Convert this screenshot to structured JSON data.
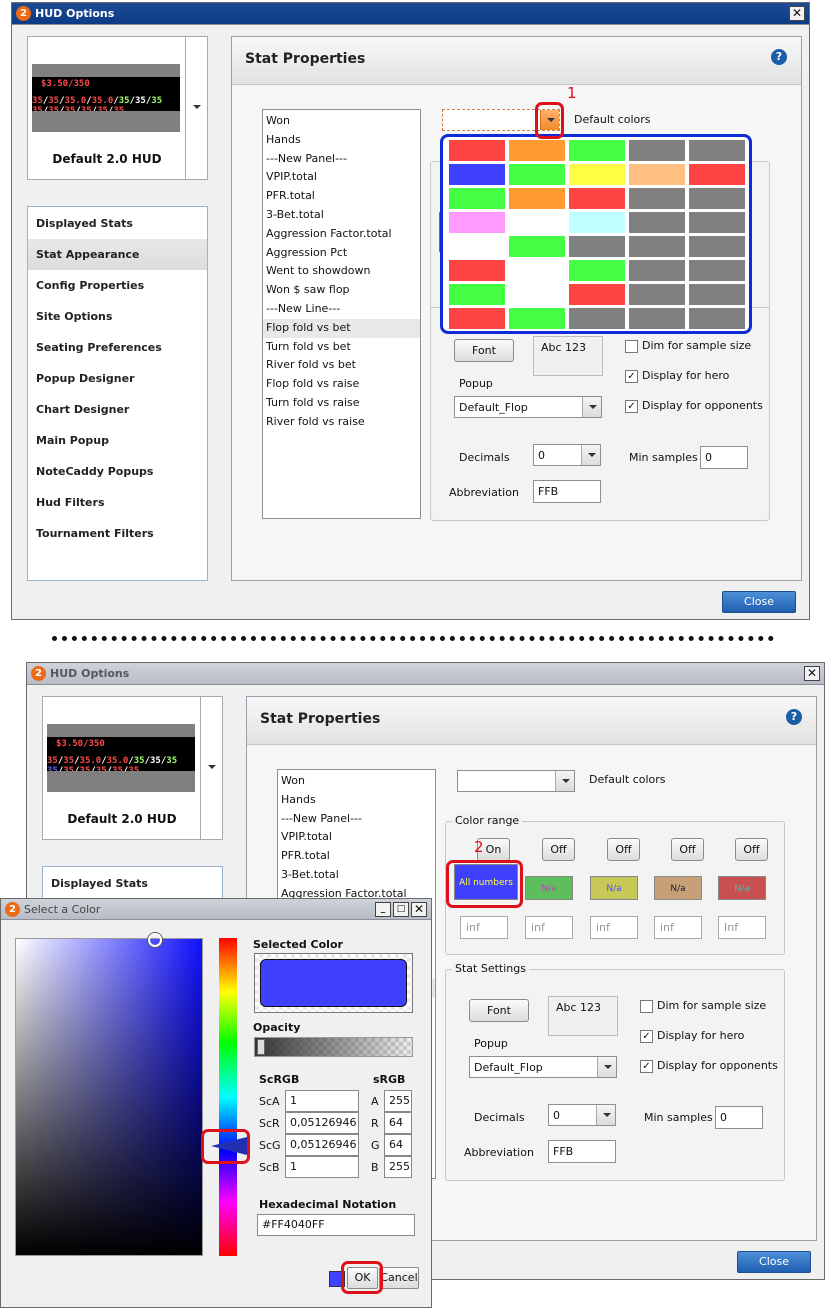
{
  "colors": {
    "accent_red": "#e0101a",
    "palette_border": "#0d2bd6",
    "selected_color": "#4040ff"
  },
  "window": {
    "title": "HUD Options",
    "logo": "2",
    "close_glyph": "✕"
  },
  "hud_preview": {
    "top_line": "$3.50/350",
    "line1": [
      {
        "t": "35",
        "c": "#ff4a4a"
      },
      {
        "t": "/",
        "c": "#ffffff"
      },
      {
        "t": "35",
        "c": "#ff4a4a"
      },
      {
        "t": "/",
        "c": "#ffffff"
      },
      {
        "t": "35.0",
        "c": "#ff4a4a"
      },
      {
        "t": "/",
        "c": "#ffffff"
      },
      {
        "t": "35.0",
        "c": "#ff4a4a"
      },
      {
        "t": "/",
        "c": "#ffffff"
      },
      {
        "t": "35",
        "c": "#9dff6a"
      },
      {
        "t": "/",
        "c": "#ffffff"
      },
      {
        "t": "35",
        "c": "#ffffff"
      },
      {
        "t": "/",
        "c": "#ffffff"
      },
      {
        "t": "35",
        "c": "#9dff6a"
      }
    ],
    "line2": [
      {
        "t": "35",
        "c": "#ff4a4a"
      },
      {
        "t": "/",
        "c": "#ffffff"
      },
      {
        "t": "35",
        "c": "#ff4a4a"
      },
      {
        "t": "/",
        "c": "#ffffff"
      },
      {
        "t": "35",
        "c": "#ff4a4a"
      },
      {
        "t": "/",
        "c": "#ffffff"
      },
      {
        "t": "35",
        "c": "#ff4a4a"
      },
      {
        "t": "/",
        "c": "#ffffff"
      },
      {
        "t": "35",
        "c": "#ff4a4a"
      },
      {
        "t": "/",
        "c": "#ffffff"
      },
      {
        "t": "35",
        "c": "#ff4a4a"
      }
    ],
    "line2_bottom": [
      {
        "t": "35",
        "c": "#5a5aff"
      },
      {
        "t": "/",
        "c": "#ffffff"
      },
      {
        "t": "35",
        "c": "#ff4a4a"
      },
      {
        "t": "/",
        "c": "#ffffff"
      },
      {
        "t": "35",
        "c": "#ff4a4a"
      },
      {
        "t": "/",
        "c": "#ffffff"
      },
      {
        "t": "35",
        "c": "#ff4a4a"
      },
      {
        "t": "/",
        "c": "#ffffff"
      },
      {
        "t": "35",
        "c": "#ff4a4a"
      },
      {
        "t": "/",
        "c": "#ffffff"
      },
      {
        "t": "35",
        "c": "#ff4a4a"
      }
    ],
    "name": "Default 2.0 HUD"
  },
  "sidebar": {
    "items": [
      "Displayed Stats",
      "Stat Appearance",
      "Config Properties",
      "Site Options",
      "Seating Preferences",
      "Popup Designer",
      "Chart Designer",
      "Main Popup",
      "NoteCaddy Popups",
      "Hud Filters",
      "Tournament Filters"
    ],
    "selected": "Stat Appearance"
  },
  "panel": {
    "title": "Stat Properties",
    "help": "?"
  },
  "stats_list": [
    "Won",
    "Hands",
    "---New Panel---",
    "VPIP.total",
    "PFR.total",
    "3-Bet.total",
    "Aggression Factor.total",
    "Aggression Pct",
    "Went to showdown",
    "Won $ saw flop",
    "---New Line---",
    "Flop fold vs bet",
    "Turn fold vs bet",
    "River fold vs bet",
    "Flop fold vs raise",
    "Turn fold vs raise",
    "River fold vs raise"
  ],
  "stats_selected": "Flop fold vs bet",
  "default_colors_label": "Default colors",
  "palette": [
    [
      "#ff4444",
      "#ff9a33",
      "#44ff44",
      "#808080",
      "#808080"
    ],
    [
      "#3f3fff",
      "#44ff44",
      "#ffff44",
      "#ffbf80",
      "#ff4444"
    ],
    [
      "#44ff44",
      "#ff9a33",
      "#ff4444",
      "#808080",
      "#808080"
    ],
    [
      "#ff9aff",
      "#ffffff",
      "#c0ffff",
      "#808080",
      "#808080"
    ],
    [
      "#ffffff",
      "#44ff44",
      "#808080",
      "#808080",
      "#808080"
    ],
    [
      "#ff4444",
      "#ffffff",
      "#44ff44",
      "#808080",
      "#808080"
    ],
    [
      "#44ff44",
      "#ffffff",
      "#ff4444",
      "#808080",
      "#808080"
    ],
    [
      "#ff4444",
      "#44ff44",
      "#808080",
      "#808080",
      "#808080"
    ]
  ],
  "color_range": {
    "label": "Color range",
    "toggles": [
      "On",
      "Off",
      "Off",
      "Off",
      "Off"
    ],
    "cells": [
      {
        "text": "All numbers",
        "bg": "#4040ff",
        "fg": "#ffff44"
      },
      {
        "text": "N/a",
        "bg": "#5cbf5c",
        "fg": "#c040c0"
      },
      {
        "text": "N/a",
        "bg": "#c8c858",
        "fg": "#5050ff"
      },
      {
        "text": "N/a",
        "bg": "#c8a078",
        "fg": "#222222"
      },
      {
        "text": "N/a",
        "bg": "#c85050",
        "fg": "#40c0c0"
      }
    ],
    "infs": [
      "inf",
      "inf",
      "inf",
      "inf",
      "Inf"
    ]
  },
  "stat_settings": {
    "label": "Stat Settings",
    "font_button": "Font",
    "font_sample": "Abc 123",
    "dim_label": "Dim for sample size",
    "dim_checked": false,
    "hero_label": "Display for hero",
    "hero_checked": true,
    "opp_label": "Display for opponents",
    "opp_checked": true,
    "popup_label": "Popup",
    "popup_value": "Default_Flop",
    "decimals_label": "Decimals",
    "decimals_value": "0",
    "min_samples_label": "Min samples",
    "min_samples_value": "0",
    "abbr_label": "Abbreviation",
    "abbr_value": "FFB",
    "check_glyph": "✓"
  },
  "close_button": "Close",
  "markers": {
    "one": "1",
    "two": "2"
  },
  "color_dialog": {
    "title": "Select a Color",
    "selected_color_label": "Selected Color",
    "opacity_label": "Opacity",
    "scrgb_label": "ScRGB",
    "srgb_label": "sRGB",
    "sc_labels": [
      "ScA",
      "ScR",
      "ScG",
      "ScB"
    ],
    "sc_values": [
      "1",
      "0,05126946",
      "0,05126946",
      "1"
    ],
    "s_labels": [
      "A",
      "R",
      "G",
      "B"
    ],
    "s_values": [
      "255",
      "64",
      "64",
      "255"
    ],
    "hex_label": "Hexadecimal Notation",
    "hex_value": "#FF4040FF",
    "ok": "OK",
    "cancel": "Cancel"
  }
}
